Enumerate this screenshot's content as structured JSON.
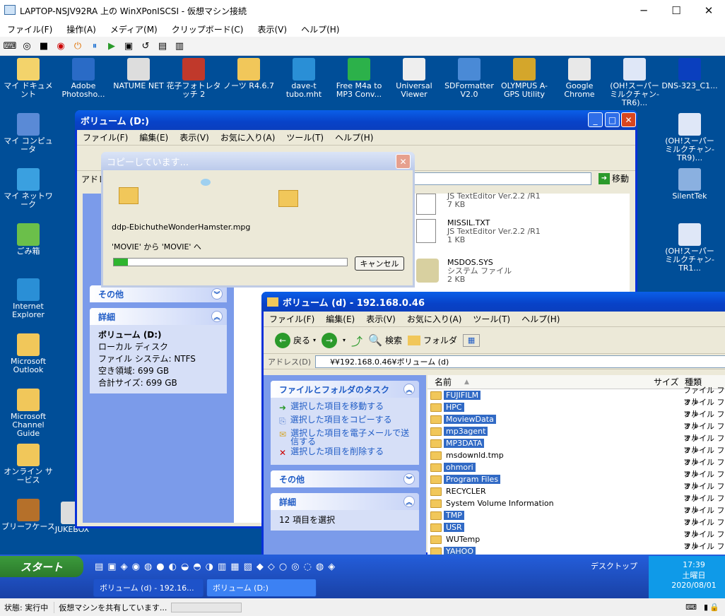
{
  "host": {
    "title": "LAPTOP-NSJV92RA 上の WinXPonISCSI - 仮想マシン接続",
    "menu": [
      "ファイル(F)",
      "操作(A)",
      "メディア(M)",
      "クリップボード(C)",
      "表示(V)",
      "ヘルプ(H)"
    ]
  },
  "desktop_icons": [
    {
      "label": "マイ ドキュメント"
    },
    {
      "label": "Adobe Photosho..."
    },
    {
      "label": "NATUME NET"
    },
    {
      "label": "花子フォトレタッチ 2"
    },
    {
      "label": "ノーツ R4.6.7"
    },
    {
      "label": "dave-t tubo.mht"
    },
    {
      "label": "Free M4a to MP3 Conv..."
    },
    {
      "label": "Universal Viewer"
    },
    {
      "label": "SDFormatter V2.0"
    },
    {
      "label": "OLYMPUS A-GPS Utility"
    },
    {
      "label": "Google Chrome"
    },
    {
      "label": "(OH!スーパーミルクチャン-TR6)..."
    },
    {
      "label": "DNS-323_C1..."
    },
    {
      "label": "マイ コンピュータ"
    },
    {
      "label": "マイ ネットワーク"
    },
    {
      "label": "ごみ箱"
    },
    {
      "label": "Internet Explorer"
    },
    {
      "label": "Microsoft Outlook"
    },
    {
      "label": "Microsoft Channel Guide"
    },
    {
      "label": "オンライン サービス"
    },
    {
      "label": "ブリーフケース"
    },
    {
      "label": "(OH!スーパーミルクチャン-TR9)..."
    },
    {
      "label": "SilentTek"
    },
    {
      "label": "(OH!スーパーミルクチャン-TR1..."
    },
    {
      "label": "JUKEBOX"
    }
  ],
  "vol_d": {
    "title": "ボリューム (D:)",
    "menu": [
      "ファイル(F)",
      "編集(E)",
      "表示(V)",
      "お気に入り(A)",
      "ツール(T)",
      "ヘルプ(H)"
    ],
    "address_label": "アドレ",
    "go": "移動",
    "files": [
      {
        "name": "",
        "desc": "JS TextEditor Ver.2.2 /R1",
        "size": "7 KB"
      },
      {
        "name": "MISSIL.TXT",
        "desc": "JS TextEditor Ver.2.2 /R1",
        "size": "1 KB"
      },
      {
        "name": "MSDOS.SYS",
        "desc": "システム ファイル",
        "size": "2 KB"
      }
    ],
    "other_panel": "その他",
    "detail_panel": "詳細",
    "detail_name": "ボリューム (D:)",
    "detail_type": "ローカル ディスク",
    "detail_fs": "ファイル システム: NTFS",
    "detail_free": "空き領域: 699 GB",
    "detail_total": "合計サイズ: 699 GB"
  },
  "copy_dialog": {
    "title": "コピーしています...",
    "filename": "ddp-EbichutheWonderHamster.mpg",
    "from_to": "'MOVIE' から 'MOVIE' へ",
    "cancel": "キャンセル",
    "progress": 0.06
  },
  "vol_net": {
    "title": "ボリューム (d) - 192.168.0.46",
    "menu": [
      "ファイル(F)",
      "編集(E)",
      "表示(V)",
      "お気に入り(A)",
      "ツール(T)",
      "ヘルプ(H)"
    ],
    "back": "戻る",
    "search": "検索",
    "folders": "フォルダ",
    "address_label": "アドレス(D)",
    "address": "¥¥192.168.0.46¥ボリューム (d)",
    "task_panel": "ファイルとフォルダのタスク",
    "tasks": [
      "選択した項目を移動する",
      "選択した項目をコピーする",
      "選択した項目を電子メールで送信する",
      "選択した項目を削除する"
    ],
    "other_panel": "その他",
    "detail_panel": "詳細",
    "detail_text": "12 項目を選択",
    "col_name": "名前",
    "col_size": "サイズ",
    "col_type": "種類",
    "rows": [
      {
        "name": "FUJIFILM",
        "sel": true
      },
      {
        "name": "HPC",
        "sel": true
      },
      {
        "name": "MoviewData",
        "sel": true
      },
      {
        "name": "mp3agent",
        "sel": true
      },
      {
        "name": "MP3DATA",
        "sel": true
      },
      {
        "name": "msdownld.tmp",
        "sel": false
      },
      {
        "name": "ohmori",
        "sel": true
      },
      {
        "name": "Program Files",
        "sel": true
      },
      {
        "name": "RECYCLER",
        "sel": false
      },
      {
        "name": "System Volume Information",
        "sel": false
      },
      {
        "name": "TMP",
        "sel": true
      },
      {
        "name": "USR",
        "sel": true
      },
      {
        "name": "WUTemp",
        "sel": false
      },
      {
        "name": "YAHOO",
        "sel": true
      }
    ],
    "type_val": "ファイル フォル"
  },
  "taskbar": {
    "start": "スタート",
    "tasks": [
      "ボリューム (d) - 192.16...",
      "ボリューム (D:)"
    ],
    "desktop_label": "デスクトップ",
    "time": "17:39",
    "day": "土曜日",
    "date": "2020/08/01"
  },
  "statusbar": {
    "state": "状態: 実行中",
    "share": "仮想マシンを共有しています..."
  }
}
